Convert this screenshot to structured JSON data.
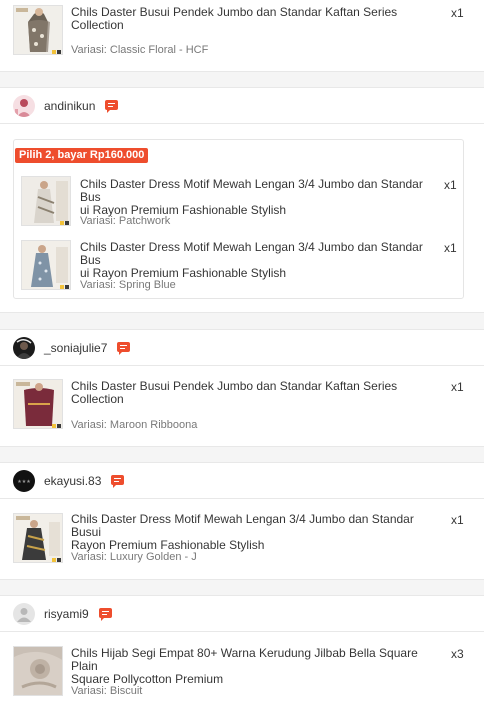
{
  "items": [
    {
      "title": "Chils Daster Busui Pendek Jumbo dan Standar Kaftan Series Collection",
      "variant": "Variasi: Classic Floral - HCF",
      "qty": "x1"
    }
  ],
  "orders": [
    {
      "buyer": "andinikun",
      "bundle_label": "Pilih 2, bayar Rp160.000",
      "items": [
        {
          "title_l1": "Chils Daster Dress Motif Mewah Lengan 3/4 Jumbo dan Standar Bus",
          "title_l2": "ui Rayon Premium Fashionable Stylish",
          "variant": "Variasi: Patchwork",
          "qty": "x1"
        },
        {
          "title_l1": "Chils Daster Dress Motif Mewah Lengan 3/4 Jumbo dan Standar Bus",
          "title_l2": "ui Rayon Premium Fashionable Stylish",
          "variant": "Variasi: Spring Blue",
          "qty": "x1"
        }
      ]
    },
    {
      "buyer": "_soniajulie7",
      "items": [
        {
          "title": "Chils Daster Busui Pendek Jumbo dan Standar Kaftan Series Collection",
          "variant": "Variasi: Maroon Ribboona",
          "qty": "x1"
        }
      ]
    },
    {
      "buyer": "ekayusi.83",
      "items": [
        {
          "title_l1": "Chils Daster Dress Motif Mewah Lengan 3/4 Jumbo dan Standar Busui",
          "title_l2": "Rayon Premium Fashionable Stylish",
          "variant": "Variasi: Luxury Golden - J",
          "qty": "x1"
        }
      ]
    },
    {
      "buyer": "risyami9",
      "items": [
        {
          "title_l1": "Chils Hijab Segi Empat 80+ Warna Kerudung Jilbab Bella Square Plain",
          "title_l2": "Square Pollycotton Premium",
          "variant": "Variasi: Biscuit",
          "qty": "x3"
        }
      ]
    }
  ],
  "icons": {
    "chat": "chat-bubble-icon",
    "avatar_default": "user-silhouette-icon"
  },
  "colors": {
    "accent": "#ee4d2d",
    "divider": "#e8e8e8",
    "background": "#f5f5f5"
  }
}
